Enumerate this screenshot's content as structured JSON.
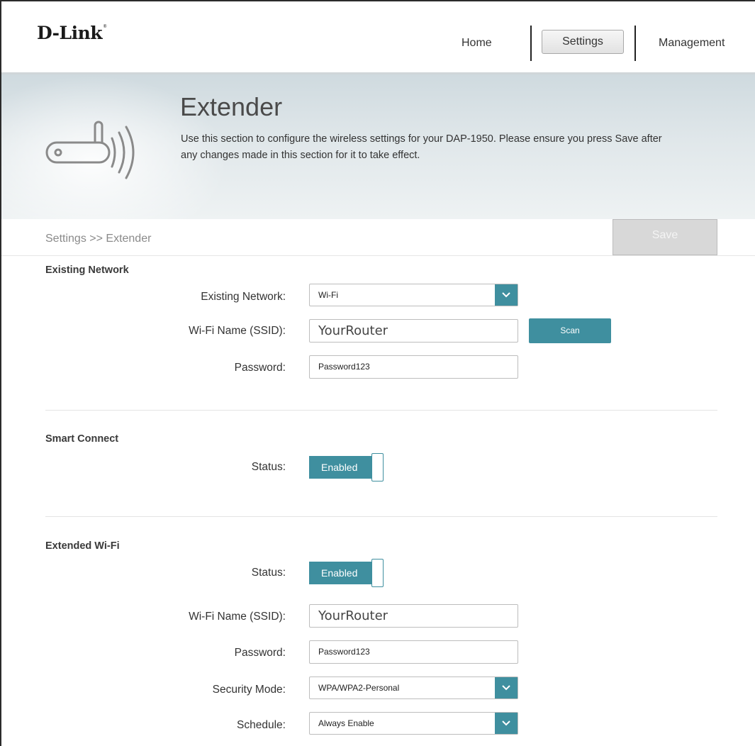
{
  "header": {
    "logo": "D-Link",
    "logo_mark": "®",
    "nav": {
      "home": "Home",
      "settings": "Settings",
      "management": "Management"
    }
  },
  "banner": {
    "title": "Extender",
    "description": "Use this section to configure the wireless settings for your DAP-1950. Please ensure you press Save after any changes made in this section for it to take effect.",
    "icon": "wireless-extender-icon"
  },
  "breadcrumb": {
    "path": "Settings >> Extender",
    "save_label": "Save"
  },
  "existing_network": {
    "title": "Existing Network",
    "network_label": "Existing Network:",
    "network_value": "Wi-Fi",
    "ssid_label": "Wi-Fi Name (SSID):",
    "ssid_value": "YourRouter",
    "scan_label": "Scan",
    "password_label": "Password:",
    "password_value": "Password123"
  },
  "smart_connect": {
    "title": "Smart Connect",
    "status_label": "Status:",
    "status_value": "Enabled"
  },
  "extended_wifi": {
    "title": "Extended Wi-Fi",
    "status_label": "Status:",
    "status_value": "Enabled",
    "ssid_label": "Wi-Fi Name (SSID):",
    "ssid_value": "YourRouter",
    "password_label": "Password:",
    "password_value": "Password123",
    "security_label": "Security Mode:",
    "security_value": "WPA/WPA2-Personal",
    "schedule_label": "Schedule:",
    "schedule_value": "Always Enable"
  },
  "colors": {
    "accent": "#3f8f9f",
    "save_disabled": "#d8d8d8"
  }
}
